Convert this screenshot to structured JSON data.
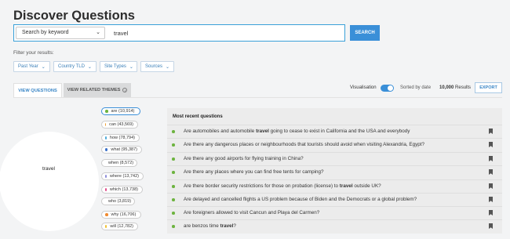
{
  "page": {
    "title": "Discover Questions"
  },
  "search": {
    "mode_label": "Search by keyword",
    "query": "travel",
    "button_label": "SEARCH"
  },
  "filters": {
    "label": "Filter your results:",
    "buttons": [
      "Past Year",
      "Country TLD",
      "Site Types",
      "Sources"
    ]
  },
  "tabs": [
    {
      "label": "VIEW QUESTIONS",
      "active": true
    },
    {
      "label": "VIEW RELATED THEMES",
      "active": false
    }
  ],
  "toolbar": {
    "visualisation_label": "Visualisation",
    "visualisation_on": true,
    "sorted_label": "Sorted by date",
    "results_count": "10,000",
    "results_label": "Results",
    "export_label": "EXPORT"
  },
  "visual": {
    "center_label": "travel",
    "words": [
      {
        "label": "are (10,914)",
        "color": "#6db33f",
        "selected": true
      },
      {
        "label": "can (43,569)",
        "color": "#f0a030",
        "selected": false
      },
      {
        "label": "how (78,794)",
        "color": "#4aa8d8",
        "selected": false
      },
      {
        "label": "what (95,387)",
        "color": "#3a70c8",
        "selected": false
      },
      {
        "label": "when (8,572)",
        "color": "#9a5cc8",
        "selected": false
      },
      {
        "label": "where (13,742)",
        "color": "#8a8ad8",
        "selected": false
      },
      {
        "label": "which (13,738)",
        "color": "#e04a8a",
        "selected": false
      },
      {
        "label": "who (3,819)",
        "color": "#d83a3a",
        "selected": false
      },
      {
        "label": "why (16,706)",
        "color": "#f08a30",
        "selected": false
      },
      {
        "label": "will (12,782)",
        "color": "#f0c030",
        "selected": false
      }
    ]
  },
  "questions": {
    "header": "Most recent questions",
    "items": [
      {
        "before": "Are automobiles and automobile ",
        "keyword": "travel",
        "after": " going to cease to exist in California and the USA and everybody"
      },
      {
        "before": "Are there any dangerous places or neighbourhoods that tourists should avoid when visiting Alexandria, Egypt?",
        "keyword": "",
        "after": ""
      },
      {
        "before": "Are there any good airports for flying training in China?",
        "keyword": "",
        "after": ""
      },
      {
        "before": "Are there any places where you can find free tents for camping?",
        "keyword": "",
        "after": ""
      },
      {
        "before": "Are there border security restrictions for those on probation (license) to ",
        "keyword": "travel",
        "after": " outside UK?"
      },
      {
        "before": "Are delayed and cancelled flights a US problem because of Biden and the Democrats or a global problem?",
        "keyword": "",
        "after": ""
      },
      {
        "before": "Are foreigners allowed to visit Cancun and Playa del Carmen?",
        "keyword": "",
        "after": ""
      },
      {
        "before": "are benzos time ",
        "keyword": "travel",
        "after": "?"
      }
    ]
  }
}
